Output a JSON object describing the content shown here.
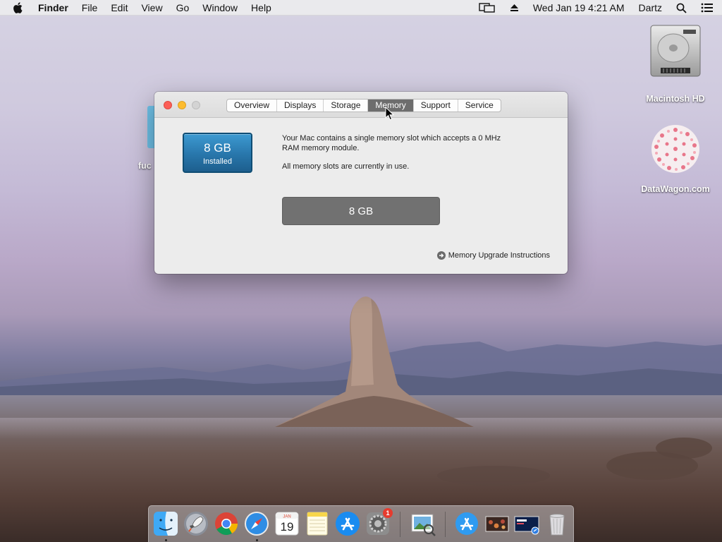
{
  "menubar": {
    "apple_icon": "apple-logo-icon",
    "app_name": "Finder",
    "menus": [
      "File",
      "Edit",
      "View",
      "Go",
      "Window",
      "Help"
    ],
    "clock": "Wed Jan 19  4:21 AM",
    "user": "Dartz",
    "status_icons": [
      "display-mirroring-icon",
      "eject-icon",
      "spotlight-search-icon",
      "notification-center-icon"
    ]
  },
  "desktop": {
    "icons": [
      {
        "label": "Macintosh HD",
        "icon": "hard-drive-icon"
      },
      {
        "label": "DataWagon.com",
        "icon": "image-file-icon"
      }
    ],
    "partial_label": "fuc"
  },
  "about_window": {
    "tabs": [
      "Overview",
      "Displays",
      "Storage",
      "Memory",
      "Support",
      "Service"
    ],
    "active_tab": "Memory",
    "installed": {
      "size": "8 GB",
      "label": "Installed"
    },
    "description_1": "Your Mac contains a single memory slot which accepts a 0 MHz RAM memory module.",
    "description_2": "All memory slots are currently in use.",
    "slot_label": "8 GB",
    "upgrade_link": "Memory Upgrade Instructions"
  },
  "dock": {
    "apps": [
      {
        "name": "Finder",
        "icon": "finder-icon",
        "running": true
      },
      {
        "name": "Launchpad",
        "icon": "launchpad-icon",
        "running": false
      },
      {
        "name": "Google Chrome",
        "icon": "chrome-icon",
        "running": false
      },
      {
        "name": "Safari",
        "icon": "safari-icon",
        "running": true
      },
      {
        "name": "Calendar",
        "icon": "calendar-icon",
        "running": false,
        "date_label": "19",
        "month_label": "JAN"
      },
      {
        "name": "Notes",
        "icon": "notes-icon",
        "running": false
      },
      {
        "name": "App Store",
        "icon": "app-store-icon",
        "running": false
      },
      {
        "name": "System Preferences",
        "icon": "system-preferences-icon",
        "running": false,
        "badge": "1"
      },
      {
        "name": "Preview",
        "icon": "preview-icon",
        "running": false
      },
      {
        "name": "Applications",
        "icon": "applications-folder-icon",
        "running": false
      },
      {
        "name": "Photo Stack",
        "icon": "photo-stack-icon",
        "running": false
      },
      {
        "name": "Downloads",
        "icon": "downloads-stack-icon",
        "running": false
      },
      {
        "name": "Trash",
        "icon": "trash-icon",
        "running": false
      }
    ]
  },
  "colors": {
    "accent": "#2876ab",
    "active_tab": "#6d6d6d",
    "close": "#fc5f57",
    "minimize": "#fdbc2e",
    "zoom_disabled": "#d3d3d3"
  }
}
